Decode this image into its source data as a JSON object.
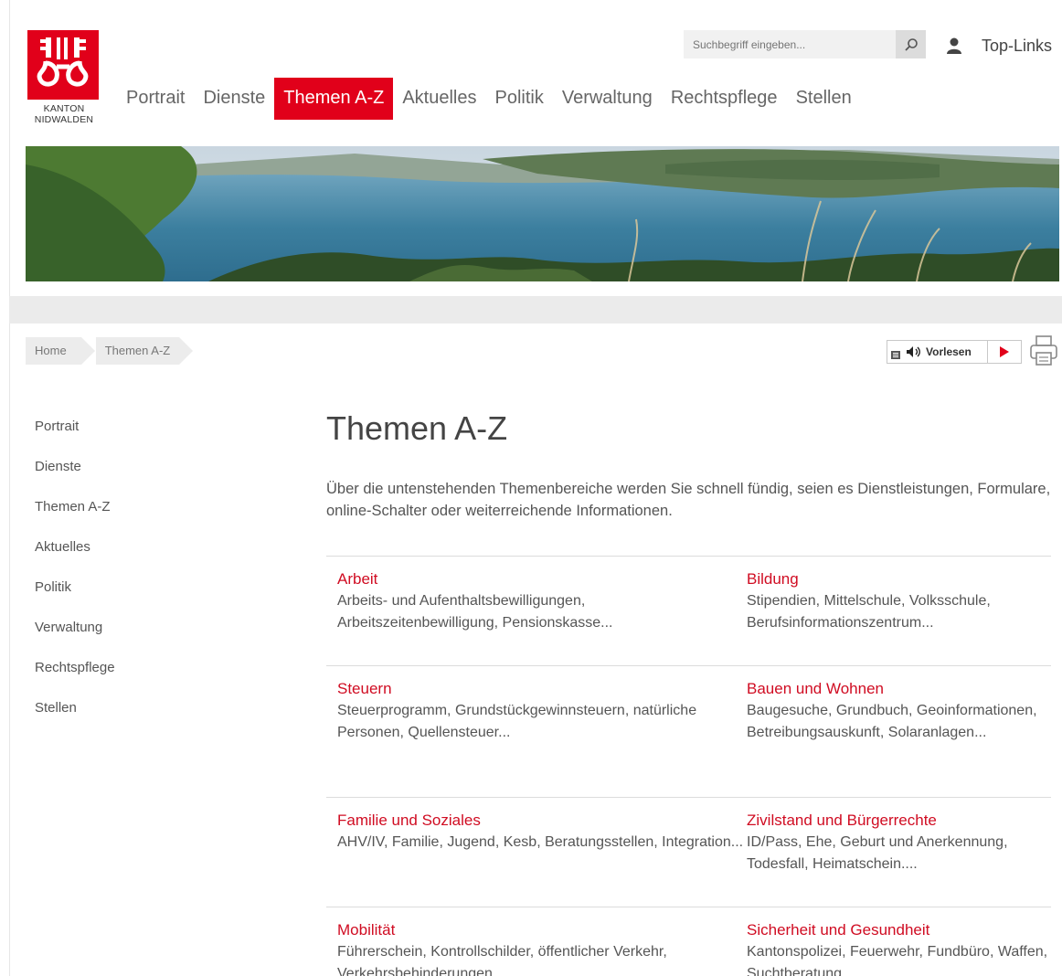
{
  "brand": {
    "logo_text_line1": "KANTON",
    "logo_text_line2": "NIDWALDEN",
    "color": "#e1001a"
  },
  "header": {
    "search_placeholder": "Suchbegriff eingeben...",
    "search_icon": "search-icon",
    "toplinks_label": "Top-Links",
    "toplinks_icon": "user-icon"
  },
  "main_nav": {
    "items": [
      {
        "label": "Portrait"
      },
      {
        "label": "Dienste"
      },
      {
        "label": "Themen A-Z",
        "active": true
      },
      {
        "label": "Aktuelles"
      },
      {
        "label": "Politik"
      },
      {
        "label": "Verwaltung"
      },
      {
        "label": "Rechtspflege"
      },
      {
        "label": "Stellen"
      }
    ]
  },
  "breadcrumb": {
    "items": [
      {
        "label": "Home"
      },
      {
        "label": "Themen A-Z"
      }
    ]
  },
  "tools": {
    "readaloud_label": "Vorlesen",
    "readaloud_icon": "speaker-icon",
    "play_icon": "play-icon",
    "print_icon": "printer-icon"
  },
  "side_nav": {
    "items": [
      {
        "label": "Portrait"
      },
      {
        "label": "Dienste"
      },
      {
        "label": "Themen A-Z"
      },
      {
        "label": "Aktuelles"
      },
      {
        "label": "Politik"
      },
      {
        "label": "Verwaltung"
      },
      {
        "label": "Rechtspflege"
      },
      {
        "label": "Stellen"
      }
    ]
  },
  "main": {
    "title": "Themen A-Z",
    "intro": "Über die untenstehenden Themenbereiche werden Sie schnell fündig, seien es Dienstleistungen, Formulare, online-Schalter oder weiterreichende Informationen.",
    "topics": [
      {
        "title": "Arbeit",
        "desc": "Arbeits- und Aufenthaltsbewilligungen, Arbeitszeitenbewilligung, Pensionskasse..."
      },
      {
        "title": "Bildung",
        "desc": "Stipendien, Mittelschule, Volksschule, Berufsinformationszentrum..."
      },
      {
        "title": "Steuern",
        "desc": "Steuerprogramm, Grundstückgewinnsteuern, natürliche Personen, Quellensteuer..."
      },
      {
        "title": "Bauen und Wohnen",
        "desc": "Baugesuche, Grundbuch, Geoinformationen, Betreibungsauskunft, Solaranlagen..."
      },
      {
        "title": "Familie und Soziales",
        "desc": "AHV/IV, Familie, Jugend, Kesb, Beratungsstellen, Integration..."
      },
      {
        "title": "Zivilstand und Bürgerrechte",
        "desc": "ID/Pass, Ehe, Geburt und Anerkennung, Todesfall, Heimatschein...."
      },
      {
        "title": "Mobilität",
        "desc": "Führerschein, Kontrollschilder, öffentlicher Verkehr, Verkehrsbehinderungen..."
      },
      {
        "title": "Sicherheit und Gesundheit",
        "desc": "Kantonspolizei, Feuerwehr, Fundbüro, Waffen, Suchtberatung..."
      }
    ],
    "title_color": "#d00c22"
  }
}
